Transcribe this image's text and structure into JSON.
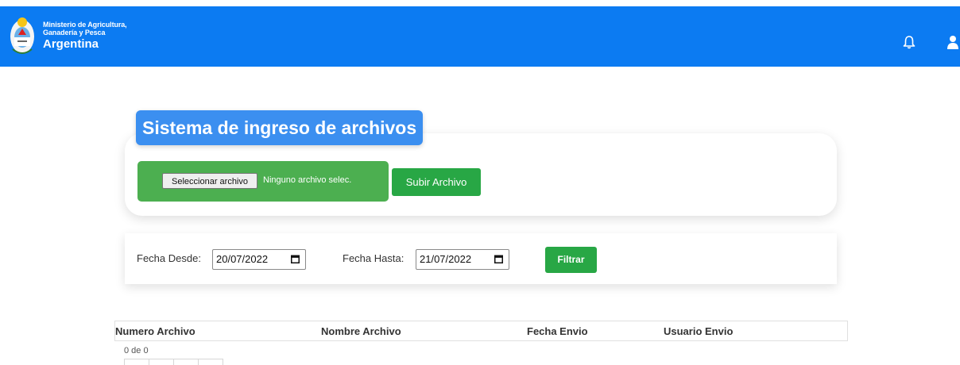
{
  "header": {
    "org_line1": "Ministerio de Agricultura,",
    "org_line2": "Ganadería y Pesca",
    "country": "Argentina",
    "background_color": "#0c7bf2",
    "icons": [
      "argentina-coat-of-arms-icon",
      "bell-icon",
      "user-icon"
    ]
  },
  "upload": {
    "title": "Sistema de ingreso de archivos",
    "choose_file_label": "Seleccionar archivo",
    "file_status": "Ninguno archivo selec.",
    "upload_button": "Subir Archivo"
  },
  "filter": {
    "from_label": "Fecha Desde:",
    "from_value": "20/07/2022",
    "to_label": "Fecha Hasta:",
    "to_value": "21/07/2022",
    "filter_button": "Filtrar"
  },
  "table": {
    "columns": [
      "Numero Archivo",
      "Nombre Archivo",
      "Fecha Envio",
      "Usuario Envio"
    ],
    "count_text": "0 de 0"
  },
  "colors": {
    "primary_blue": "#0c7bf2",
    "title_blue": "#3b8ff0",
    "success_green": "#28a745",
    "file_box_green": "#4caf50"
  }
}
